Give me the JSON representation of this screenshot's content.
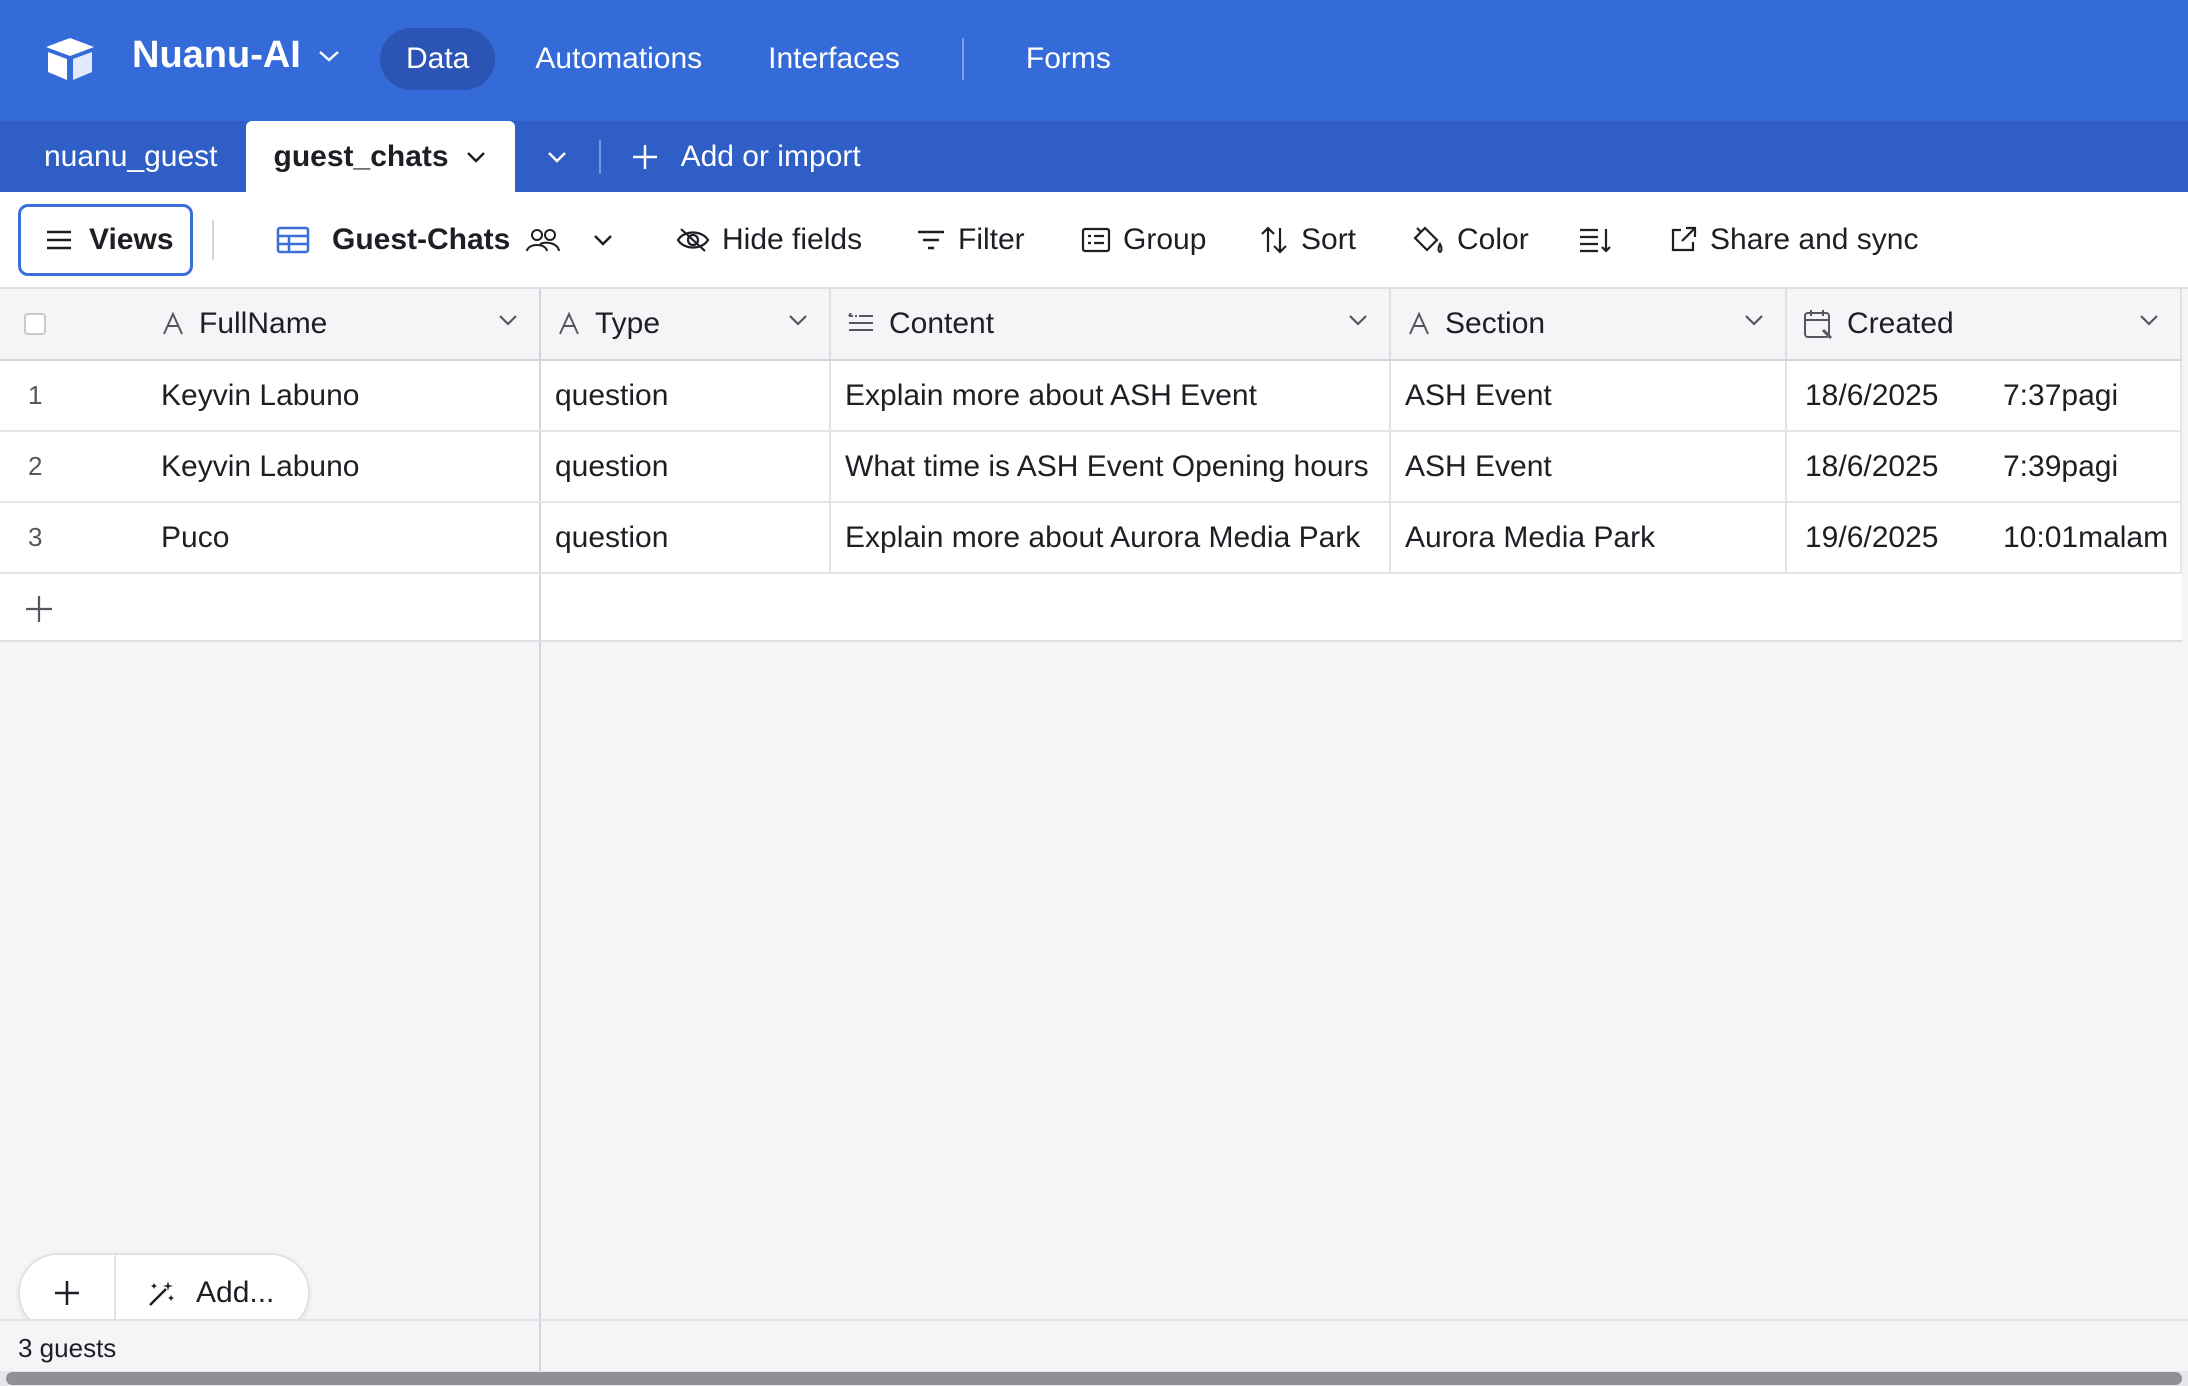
{
  "app": {
    "title": "Nuanu-AI"
  },
  "nav": {
    "items": [
      "Data",
      "Automations",
      "Interfaces",
      "Forms"
    ],
    "active": "Data"
  },
  "tabs": {
    "items": [
      "nuanu_guest",
      "guest_chats"
    ],
    "active": "guest_chats",
    "add_label": "Add or import"
  },
  "toolbar": {
    "views_label": "Views",
    "view_name": "Guest-Chats",
    "hide_fields": "Hide fields",
    "filter": "Filter",
    "group": "Group",
    "sort": "Sort",
    "color": "Color",
    "share": "Share and sync"
  },
  "table": {
    "columns": [
      "FullName",
      "Type",
      "Content",
      "Section",
      "Created"
    ],
    "rows": [
      {
        "num": "1",
        "fullname": "Keyvin Labuno",
        "type": "question",
        "content": "Explain more about ASH Event",
        "section": "ASH Event",
        "date": "18/6/2025",
        "time": "7:37pagi"
      },
      {
        "num": "2",
        "fullname": "Keyvin Labuno",
        "type": "question",
        "content": "What time is ASH Event Opening hours",
        "section": "ASH Event",
        "date": "18/6/2025",
        "time": "7:39pagi"
      },
      {
        "num": "3",
        "fullname": "Puco",
        "type": "question",
        "content": "Explain more about Aurora Media Park",
        "section": "Aurora Media Park",
        "date": "19/6/2025",
        "time": "10:01malam"
      }
    ]
  },
  "footer": {
    "add_label": "Add...",
    "record_count": "3 guests"
  },
  "colors": {
    "header_bg": "#356bd9",
    "tabbar_bg": "#2f5fc6",
    "active_nav": "#2b54b4",
    "views_border": "#3a6fd8"
  }
}
